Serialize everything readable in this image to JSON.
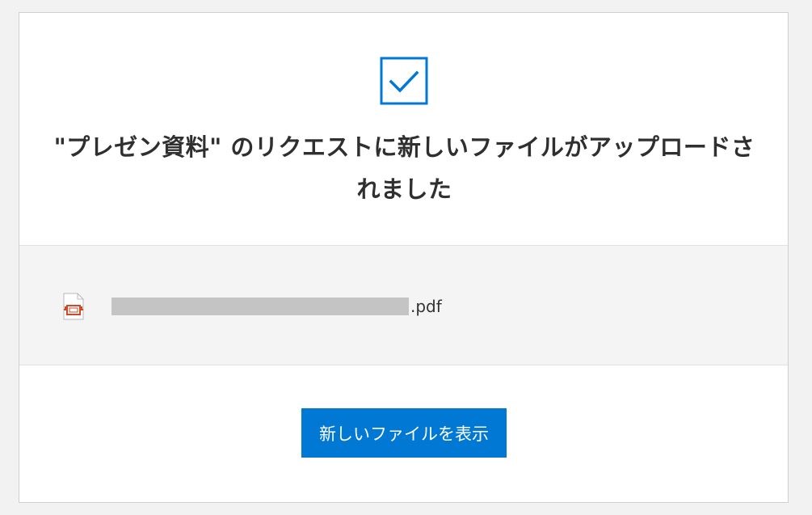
{
  "header": {
    "icon": "checkbox-checked-icon",
    "title": "\"プレゼン資料\" のリクエストに新しいファイルがアップロードされました",
    "accent_color": "#0078d4"
  },
  "file": {
    "icon": "powerpoint-file-icon",
    "icon_color": "#d24726",
    "name_extension": ".pdf"
  },
  "actions": {
    "view_new_files_label": "新しいファイルを表示",
    "button_color": "#0078d4"
  }
}
